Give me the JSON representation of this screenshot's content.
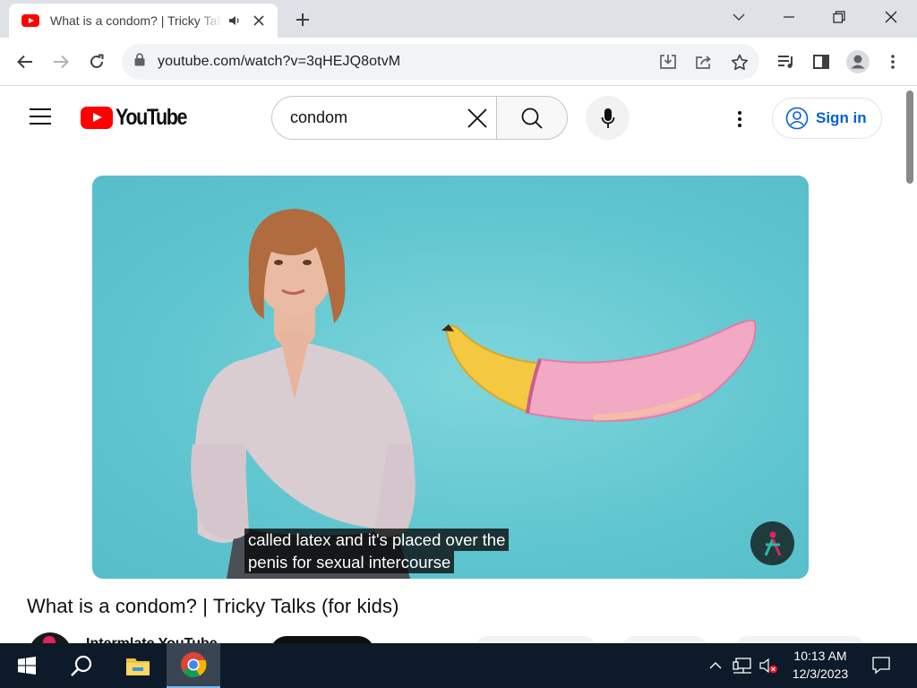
{
  "browser": {
    "tab": {
      "title": "What is a condom? | Tricky Talks (for kids) - YouTube",
      "favicon": "youtube-favicon",
      "audio": "speaker-icon"
    },
    "url": "youtube.com/watch?v=3qHEJQ8otvM",
    "toolbar_icons": [
      "back-arrow-icon",
      "forward-arrow-icon",
      "reload-icon",
      "lock-icon",
      "install-icon",
      "share-icon",
      "bookmark-star-icon",
      "media-controls-icon",
      "side-panel-icon",
      "profile-icon",
      "menu-dots-icon"
    ]
  },
  "youtube": {
    "logo_text": "YouTube",
    "search": {
      "value": "condom",
      "placeholder": "Search"
    },
    "signin_label": "Sign in",
    "colors": {
      "brand_red": "#ff0000",
      "link_blue": "#065fd4"
    }
  },
  "video": {
    "caption_line1": "called latex and it's placed over the",
    "caption_line2": "penis for sexual intercourse",
    "title": "What is a condom? | Tricky Talks (for kids)",
    "channel": "Intermlate YouTube"
  },
  "taskbar": {
    "time": "10:13 AM",
    "date": "12/3/2023",
    "icons": [
      "windows-start-icon",
      "search-icon",
      "file-explorer-icon",
      "chrome-icon",
      "tray-chevron-icon",
      "network-icon",
      "volume-muted-icon",
      "notifications-icon"
    ]
  }
}
